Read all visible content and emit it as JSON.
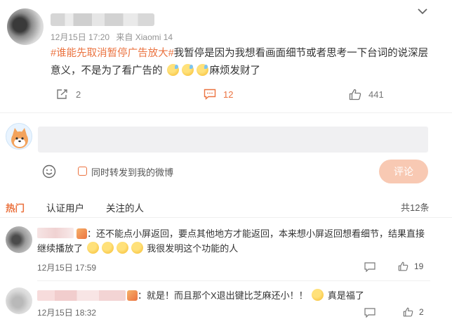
{
  "post": {
    "meta_date": "12月15日 17:20",
    "meta_source": "来自 Xiaomi 14",
    "topic": "#谁能先取消暂停广告放大#",
    "body_before": "我暂停是因为我想看画面细节或者思考一下台词的说深层意义，不是为了看广告的",
    "body_after": "麻烦发财了",
    "repost_count": "2",
    "comment_count": "12",
    "like_count": "441"
  },
  "compose": {
    "forward_label": "同时转发到我的微博",
    "submit_label": "评论"
  },
  "tabs": [
    {
      "label": "热门"
    },
    {
      "label": "认证用户"
    },
    {
      "label": "关注的人"
    }
  ],
  "total_label": "共12条",
  "comments": [
    {
      "text": "：还不能点小屏返回，要点其他地方才能返回，本来想小屏返回想看细节，结果直接继续播放了",
      "text_tail": "我很发明这个功能的人",
      "time": "12月15日 17:59",
      "likes": "19"
    },
    {
      "text": "：就是！而且那个X退出键比芝麻还小！！",
      "text_tail": "真是福了",
      "time": "12月15日 18:32",
      "likes": "2"
    }
  ],
  "colors": {
    "accent": "#eb7340",
    "submit_disabled": "#f8c9b3",
    "comment_box": "#f0f0f2"
  },
  "icons": [
    "chevron-down-icon",
    "repost-icon",
    "comment-icon",
    "like-icon",
    "smile-icon",
    "reply-icon"
  ]
}
